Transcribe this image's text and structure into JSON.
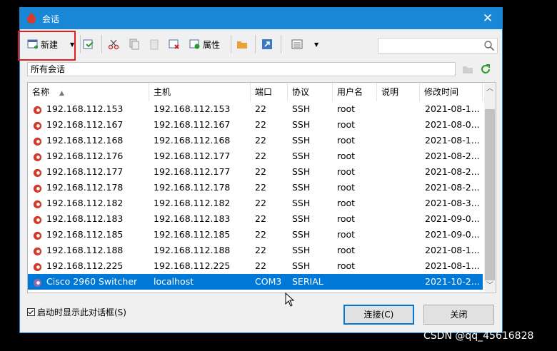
{
  "window": {
    "title": "会话",
    "close": "✕"
  },
  "toolbar": {
    "new_label": "新建",
    "properties_label": "属性"
  },
  "search": {
    "placeholder": ""
  },
  "path": {
    "text": "所有会话"
  },
  "columns": [
    "名称",
    "主机",
    "端口",
    "协议",
    "用户名",
    "说明",
    "修改时间"
  ],
  "rows": [
    {
      "name": "192.168.112.153",
      "host": "192.168.112.153",
      "port": "22",
      "protocol": "SSH",
      "user": "root",
      "desc": "",
      "modified": "2021-08-1..."
    },
    {
      "name": "192.168.112.167",
      "host": "192.168.112.167",
      "port": "22",
      "protocol": "SSH",
      "user": "root",
      "desc": "",
      "modified": "2021-08-0..."
    },
    {
      "name": "192.168.112.168",
      "host": "192.168.112.168",
      "port": "22",
      "protocol": "SSH",
      "user": "root",
      "desc": "",
      "modified": "2021-08-1..."
    },
    {
      "name": "192.168.112.176",
      "host": "192.168.112.177",
      "port": "22",
      "protocol": "SSH",
      "user": "root",
      "desc": "",
      "modified": "2021-08-2..."
    },
    {
      "name": "192.168.112.177",
      "host": "192.168.112.177",
      "port": "22",
      "protocol": "SSH",
      "user": "root",
      "desc": "",
      "modified": "2021-08-2..."
    },
    {
      "name": "192.168.112.178",
      "host": "192.168.112.178",
      "port": "22",
      "protocol": "SSH",
      "user": "root",
      "desc": "",
      "modified": "2021-08-2..."
    },
    {
      "name": "192.168.112.182",
      "host": "192.168.112.182",
      "port": "22",
      "protocol": "SSH",
      "user": "root",
      "desc": "",
      "modified": "2021-08-3..."
    },
    {
      "name": "192.168.112.183",
      "host": "192.168.112.183",
      "port": "22",
      "protocol": "SSH",
      "user": "root",
      "desc": "",
      "modified": "2021-09-0..."
    },
    {
      "name": "192.168.112.185",
      "host": "192.168.112.185",
      "port": "22",
      "protocol": "SSH",
      "user": "root",
      "desc": "",
      "modified": "2021-09-0..."
    },
    {
      "name": "192.168.112.188",
      "host": "192.168.112.188",
      "port": "22",
      "protocol": "SSH",
      "user": "root",
      "desc": "",
      "modified": "2021-08-1..."
    },
    {
      "name": "192.168.112.225",
      "host": "192.168.112.225",
      "port": "22",
      "protocol": "SSH",
      "user": "root",
      "desc": "",
      "modified": "2021-08-1..."
    },
    {
      "name": "Cisco 2960 Switcher",
      "host": "localhost",
      "port": "COM3",
      "protocol": "SERIAL",
      "user": "",
      "desc": "",
      "modified": "2021-10-2..."
    }
  ],
  "selected_index": 11,
  "footer": {
    "show_on_startup": "启动时显示此对话框(S)",
    "show_on_startup_checked": true,
    "connect_label": "连接(C)",
    "close_label": "关闭"
  },
  "watermark": "CSDN @qq_45616828",
  "colors": {
    "titlebar": "#1a86d6",
    "selection": "#0078d7",
    "ssh_icon": "#d03a26",
    "serial_icon": "#8e6aa6",
    "highlight": "#e02020"
  },
  "icons": {
    "ssh_row": "ssh-session-icon",
    "serial_row": "serial-session-icon"
  }
}
